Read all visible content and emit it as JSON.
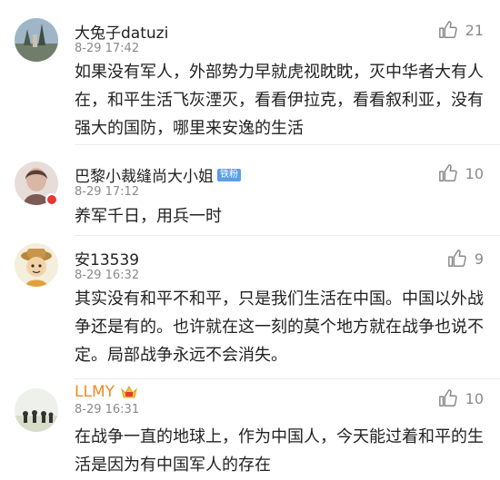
{
  "comments": [
    {
      "name": "大兔子datuzi",
      "time": "8-29 17:42",
      "likes": "21",
      "text": "如果没有军人，外部势力早就虎视眈眈，灭中华者大有人在，和平生活飞灰湮灭，看看伊拉克，看看叙利亚，没有强大的国防，哪里来安逸的生活"
    },
    {
      "name": "巴黎小裁缝尚大小姐",
      "badge": "铁粉",
      "time": "8-29 17:12",
      "likes": "10",
      "text": "养军千日，用兵一时"
    },
    {
      "name": "安13539",
      "time": "8-29 16:32",
      "likes": "9",
      "text": "其实没有和平不和平，只是我们生活在中国。中国以外战争还是有的。也许就在这一刻的莫个地方就在战争也说不定。局部战争永远不会消失。"
    },
    {
      "name": "LLMY",
      "time": "8-29 16:31",
      "likes": "10",
      "text": "在战争一直的地球上，作为中国人，今天能过着和平的生活是因为有中国军人的存在"
    }
  ],
  "icons": {
    "like": "thumbs-up-icon",
    "vip": "crown-icon",
    "verified": "verified-badge-icon"
  },
  "colors": {
    "vip_name": "#f08a24",
    "badge_bg": "#5b9ee8",
    "verified": "#e53935"
  }
}
